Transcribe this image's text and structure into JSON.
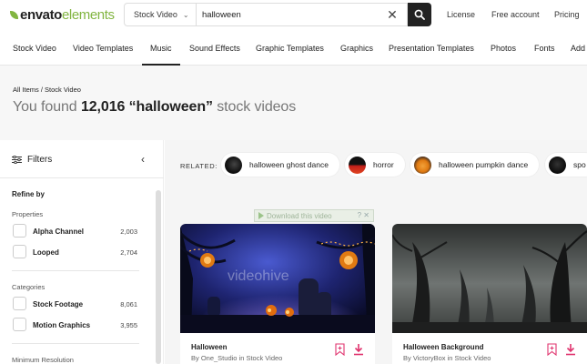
{
  "header": {
    "logo_prefix": "envato",
    "logo_suffix": "elements",
    "search_category": "Stock Video",
    "search_value": "halloween",
    "links": [
      "License",
      "Free account",
      "Pricing"
    ]
  },
  "nav": {
    "items": [
      "Stock Video",
      "Video Templates",
      "Music",
      "Sound Effects",
      "Graphic Templates",
      "Graphics",
      "Presentation Templates",
      "Photos",
      "Fonts",
      "Add"
    ],
    "active": "Music"
  },
  "breadcrumb": {
    "root": "All Items",
    "sep": "/",
    "current": "Stock Video"
  },
  "results_title": {
    "prefix": "You found",
    "count": "12,016",
    "query": "“halloween”",
    "suffix": "stock videos"
  },
  "sidebar": {
    "filters_label": "Filters",
    "refine_label": "Refine by",
    "properties_label": "Properties",
    "properties": [
      {
        "label": "Alpha Channel",
        "count": "2,003"
      },
      {
        "label": "Looped",
        "count": "2,704"
      }
    ],
    "categories_label": "Categories",
    "categories": [
      {
        "label": "Stock Footage",
        "count": "8,061"
      },
      {
        "label": "Motion Graphics",
        "count": "3,955"
      }
    ],
    "min_res_label": "Minimum Resolution"
  },
  "related": {
    "label": "RELATED:",
    "chips": [
      "halloween ghost dance",
      "horror",
      "halloween pumpkin dance",
      "spo"
    ]
  },
  "download_hint": {
    "label": "Download this video",
    "help": "? ✕"
  },
  "cards": [
    {
      "title": "Halloween",
      "byline": "By One_Studio in Stock Video",
      "watermark": "videohive"
    },
    {
      "title": "Halloween Background",
      "byline": "By VictoryBox in Stock Video"
    }
  ],
  "colors": {
    "brand_green": "#82b541",
    "accent_pink": "#e0336e"
  }
}
